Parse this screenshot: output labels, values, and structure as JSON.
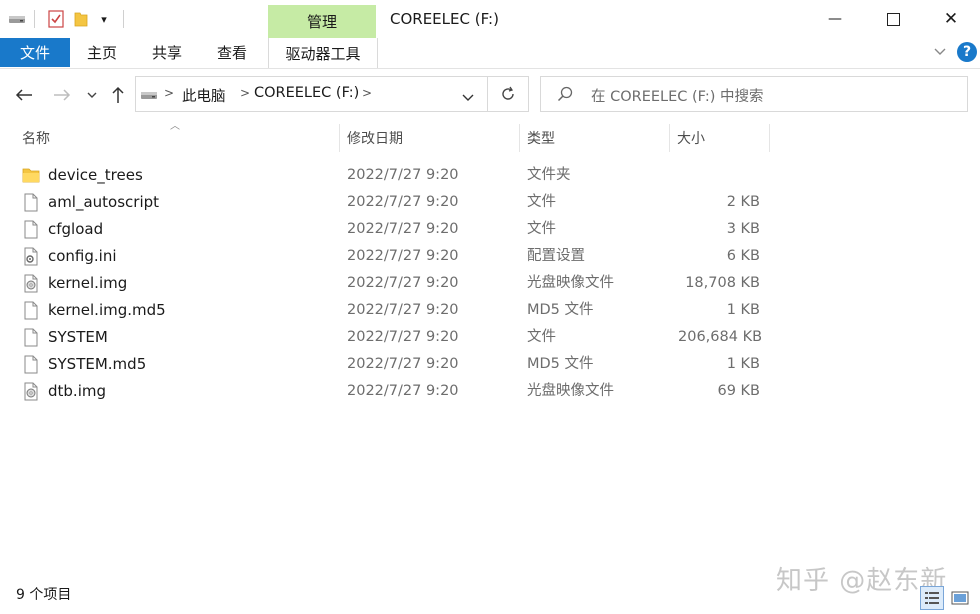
{
  "window": {
    "title": "COREELEC (F:)",
    "context_tab": "管理",
    "quick_access_dropdown": "▾",
    "minimize": "—",
    "close": "✕"
  },
  "ribbon": {
    "tabs": [
      {
        "label": "文件"
      },
      {
        "label": "主页"
      },
      {
        "label": "共享"
      },
      {
        "label": "查看"
      },
      {
        "label": "驱动器工具"
      }
    ]
  },
  "address": {
    "breadcrumb": [
      "此电脑",
      "COREELEC (F:)"
    ],
    "search_placeholder": "在 COREELEC (F:) 中搜索"
  },
  "columns": {
    "name": "名称",
    "date": "修改日期",
    "type": "类型",
    "size": "大小"
  },
  "files": [
    {
      "name": "device_trees",
      "date": "2022/7/27 9:20",
      "type": "文件夹",
      "size": "",
      "icon": "folder-icon"
    },
    {
      "name": "aml_autoscript",
      "date": "2022/7/27 9:20",
      "type": "文件",
      "size": "2 KB",
      "icon": "file-icon"
    },
    {
      "name": "cfgload",
      "date": "2022/7/27 9:20",
      "type": "文件",
      "size": "3 KB",
      "icon": "file-icon"
    },
    {
      "name": "config.ini",
      "date": "2022/7/27 9:20",
      "type": "配置设置",
      "size": "6 KB",
      "icon": "config-file-icon"
    },
    {
      "name": "kernel.img",
      "date": "2022/7/27 9:20",
      "type": "光盘映像文件",
      "size": "18,708 KB",
      "icon": "disc-image-icon"
    },
    {
      "name": "kernel.img.md5",
      "date": "2022/7/27 9:20",
      "type": "MD5 文件",
      "size": "1 KB",
      "icon": "file-icon"
    },
    {
      "name": "SYSTEM",
      "date": "2022/7/27 9:20",
      "type": "文件",
      "size": "206,684 KB",
      "icon": "file-icon"
    },
    {
      "name": "SYSTEM.md5",
      "date": "2022/7/27 9:20",
      "type": "MD5 文件",
      "size": "1 KB",
      "icon": "file-icon"
    },
    {
      "name": "dtb.img",
      "date": "2022/7/27 9:20",
      "type": "光盘映像文件",
      "size": "69 KB",
      "icon": "disc-image-icon"
    }
  ],
  "status": {
    "item_count": "9 个项目"
  },
  "watermark": "知乎 @赵东新",
  "colors": {
    "accent": "#1979ca",
    "context_tab": "#c6eba5",
    "help": "#1979ca"
  }
}
